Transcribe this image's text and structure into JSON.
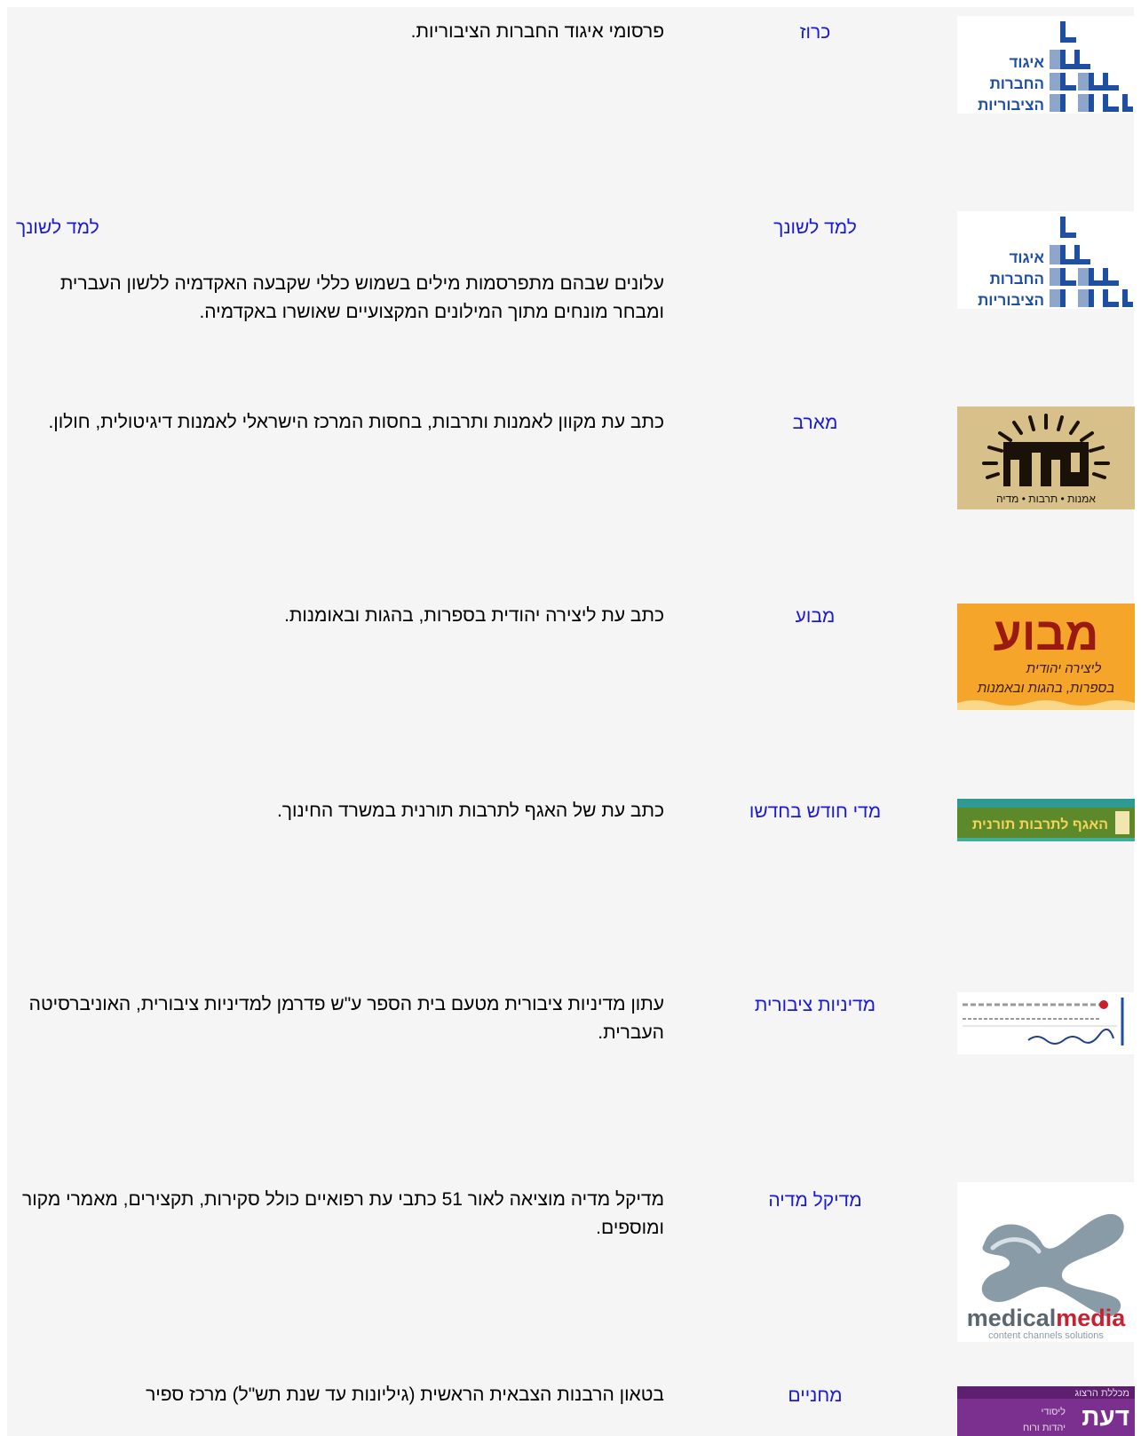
{
  "rows": [
    {
      "logo": "igud-logo",
      "title": "כרוז",
      "description": "פרסומי איגוד החברות הציבוריות."
    },
    {
      "logo": "igud-logo",
      "title": "למד לשונך",
      "description_link": "למד לשונך",
      "description": "עלונים שבהם מתפרסמות מילים בשמוש כללי שקבעה האקדמיה ללשון העברית ומבחר מונחים מתוך המילונים  המקצועיים שאושרו באקדמיה."
    },
    {
      "logo": "maarav-logo",
      "title": "מארב",
      "description": "כתב עת מקוון לאמנות ותרבות, בחסות המרכז הישראלי לאמנות דיגיטולית, חולון."
    },
    {
      "logo": "mabua-logo",
      "title": "מבוע",
      "description": "כתב עת ליצירה יהודית בספרות, בהגות ובאומנות."
    },
    {
      "logo": "agaf-logo",
      "title": "מדי חודש בחדשו",
      "description": "כתב עת של האגף לתרבות תורנית במשרד החינוך."
    },
    {
      "logo": "mediniut-logo",
      "title": "מדיניות ציבורית",
      "description": "עתון מדיניות ציבורית מטעם בית הספר ע\"ש פדרמן למדיניות ציבורית, האוניברסיטה העברית."
    },
    {
      "logo": "medicalmedia-logo",
      "title": "מדיקל מדיה",
      "description": "מדיקל מדיה מוציאה לאור 51 כתבי עת רפואיים כולל סקירות, תקצירים, מאמרי מקור ומוספים."
    },
    {
      "logo": "daat-logo",
      "title": "מחניים",
      "description": "בטאון הרבנות הצבאית הראשית (גיליונות עד שנת תש\"ל) מרכז ספיר"
    }
  ],
  "logos": {
    "igud": {
      "lines": [
        "איגוד",
        "החברות",
        "הציבוריות"
      ]
    },
    "maarav": {
      "word": "מארב",
      "tagline": "אמנות • תרבות • מדיה"
    },
    "mabua": {
      "word": "מבוע",
      "line1": "ליצירה יהודית",
      "line2": "בספרות, בהגות ובאמנות"
    },
    "agaf": {
      "text": "האגף לתרבות תורנית"
    },
    "medicalmedia": {
      "word1": "medical",
      "word2": "media",
      "tagline": "content channels solutions"
    },
    "daat": {
      "top": "מכללת הרצוג",
      "word": "דעת",
      "sub1": "ליסודי",
      "sub2": "יהדות ורוח"
    }
  },
  "colors": {
    "link": "#1a1ad6",
    "frame_bg": "#f5f5f5",
    "igud_blue": "#1f4fa0",
    "maarav_bg": "#d8c08a",
    "mabua_bg": "#f4a52a",
    "daat_bg": "#7b2f8e",
    "medical_red": "#c8202e"
  }
}
